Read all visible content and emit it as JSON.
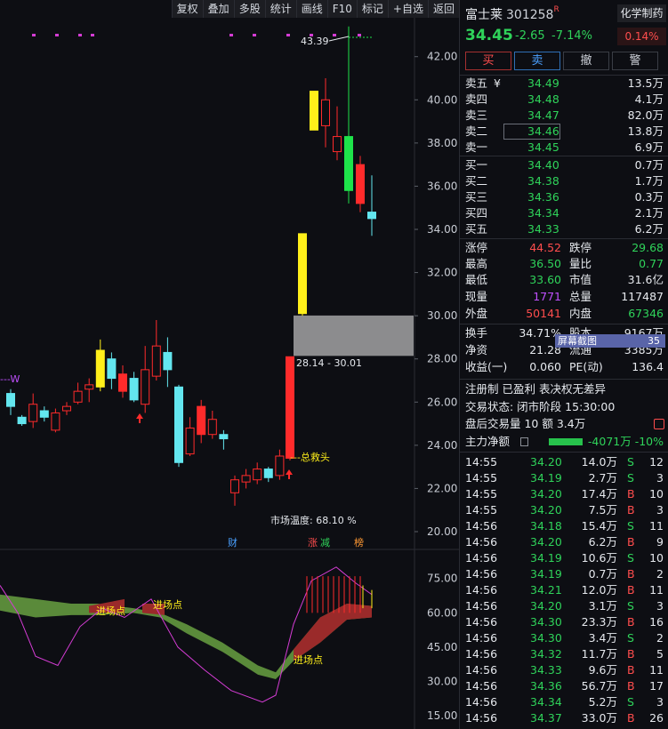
{
  "toolbar": {
    "items": [
      "复权",
      "叠加",
      "多股",
      "统计",
      "画线",
      "F10",
      "标记",
      "+自选",
      "返回"
    ]
  },
  "chart_data": {
    "type": "candlestick",
    "price_axis": [
      42.0,
      40.0,
      38.0,
      36.0,
      34.0,
      32.0,
      30.0,
      28.0,
      26.0,
      24.0,
      22.0,
      20.0
    ],
    "y_range": [
      19.3,
      43.8
    ],
    "candles": [
      {
        "o": 25.8,
        "c": 26.4,
        "h": 26.6,
        "l": 25.4,
        "color": "cyan"
      },
      {
        "o": 25.0,
        "c": 25.3,
        "h": 25.4,
        "l": 24.9,
        "color": "cyan"
      },
      {
        "o": 25.1,
        "c": 25.9,
        "h": 26.4,
        "l": 24.8,
        "color": "red"
      },
      {
        "o": 25.3,
        "c": 25.6,
        "h": 25.8,
        "l": 25.1,
        "color": "cyan"
      },
      {
        "o": 24.7,
        "c": 25.5,
        "h": 25.7,
        "l": 24.6,
        "color": "red"
      },
      {
        "o": 25.6,
        "c": 25.8,
        "h": 26.0,
        "l": 25.4,
        "color": "red"
      },
      {
        "o": 26.0,
        "c": 26.5,
        "h": 26.9,
        "l": 25.9,
        "color": "red"
      },
      {
        "o": 26.6,
        "c": 26.8,
        "h": 27.1,
        "l": 26.0,
        "color": "red"
      },
      {
        "o": 26.7,
        "c": 28.4,
        "h": 28.9,
        "l": 26.5,
        "color": "yellow"
      },
      {
        "o": 28.0,
        "c": 27.1,
        "h": 28.3,
        "l": 26.6,
        "color": "cyan"
      },
      {
        "o": 27.3,
        "c": 26.5,
        "h": 27.7,
        "l": 26.2,
        "color": "red"
      },
      {
        "o": 27.1,
        "c": 26.1,
        "h": 27.4,
        "l": 26.0,
        "color": "cyan"
      },
      {
        "o": 25.9,
        "c": 27.5,
        "h": 28.6,
        "l": 25.5,
        "color": "red"
      },
      {
        "o": 27.2,
        "c": 28.6,
        "h": 29.8,
        "l": 27.0,
        "color": "red"
      },
      {
        "o": 28.3,
        "c": 27.5,
        "h": 29.0,
        "l": 26.7,
        "color": "cyan"
      },
      {
        "o": 26.7,
        "c": 23.2,
        "h": 26.8,
        "l": 23.0,
        "color": "cyan"
      },
      {
        "o": 23.6,
        "c": 24.8,
        "h": 25.3,
        "l": 23.5,
        "color": "red"
      },
      {
        "o": 25.8,
        "c": 24.5,
        "h": 26.1,
        "l": 24.1,
        "color": "red"
      },
      {
        "o": 24.5,
        "c": 25.2,
        "h": 25.6,
        "l": 24.3,
        "color": "red"
      },
      {
        "o": 24.5,
        "c": 24.3,
        "h": 24.7,
        "l": 23.8,
        "color": "cyan"
      },
      {
        "o": 21.8,
        "c": 22.4,
        "h": 22.6,
        "l": 21.2,
        "color": "red"
      },
      {
        "o": 22.3,
        "c": 22.6,
        "h": 22.9,
        "l": 22.0,
        "color": "red"
      },
      {
        "o": 22.4,
        "c": 22.9,
        "h": 23.2,
        "l": 22.2,
        "color": "red"
      },
      {
        "o": 22.9,
        "c": 22.5,
        "h": 23.0,
        "l": 22.3,
        "color": "cyan"
      },
      {
        "o": 22.6,
        "c": 23.5,
        "h": 23.8,
        "l": 22.4,
        "color": "red"
      },
      {
        "o": 23.4,
        "c": 28.1,
        "h": 28.1,
        "l": 23.3,
        "color": "red"
      },
      {
        "o": 30.1,
        "c": 33.8,
        "h": 33.8,
        "l": 30.0,
        "color": "yellow"
      },
      {
        "o": 38.6,
        "c": 40.4,
        "h": 40.4,
        "l": 38.6,
        "color": "yellow"
      },
      {
        "o": 38.8,
        "c": 40.0,
        "h": 41.0,
        "l": 37.8,
        "color": "red"
      },
      {
        "o": 37.6,
        "c": 38.3,
        "h": 39.7,
        "l": 37.2,
        "color": "red"
      },
      {
        "o": 38.3,
        "c": 35.8,
        "h": 43.4,
        "l": 35.2,
        "color": "green"
      },
      {
        "o": 37.0,
        "c": 35.2,
        "h": 37.4,
        "l": 34.8,
        "color": "red"
      },
      {
        "o": 34.8,
        "c": 34.5,
        "h": 36.5,
        "l": 33.7,
        "color": "cyan"
      }
    ],
    "annotations": {
      "high_label": "43.39",
      "gap_label": "28.14 - 30.01",
      "rescue_label": "总救头",
      "w_label": "W",
      "market_temp": "市场温度: 68.10 %",
      "tags": [
        "财",
        "涨",
        "减",
        "榜"
      ]
    },
    "indicator_axis": [
      75.0,
      60.0,
      45.0,
      30.0,
      15.0
    ],
    "indicator_labels": [
      "进场点",
      "进场点",
      "进场点"
    ]
  },
  "stock": {
    "name": "富士莱",
    "code": "301258",
    "badge": "R",
    "sector": "化学制药",
    "price": "34.45",
    "change": "-2.65",
    "change_pct": "-7.14%",
    "small_pct": "0.14%"
  },
  "actions": [
    "买",
    "卖",
    "撤",
    "警"
  ],
  "asks": [
    {
      "label": "卖五",
      "price": "34.49",
      "vol": "13.5万",
      "mark": "¥"
    },
    {
      "label": "卖四",
      "price": "34.48",
      "vol": "4.1万",
      "mark": ""
    },
    {
      "label": "卖三",
      "price": "34.47",
      "vol": "82.0万",
      "mark": ""
    },
    {
      "label": "卖二",
      "price": "34.46",
      "vol": "13.8万",
      "mark": ""
    },
    {
      "label": "卖一",
      "price": "34.45",
      "vol": "6.9万",
      "mark": ""
    }
  ],
  "bids": [
    {
      "label": "买一",
      "price": "34.40",
      "vol": "0.7万"
    },
    {
      "label": "买二",
      "price": "34.38",
      "vol": "1.7万"
    },
    {
      "label": "买三",
      "price": "34.36",
      "vol": "0.3万"
    },
    {
      "label": "买四",
      "price": "34.34",
      "vol": "2.1万"
    },
    {
      "label": "买五",
      "price": "34.33",
      "vol": "6.2万"
    }
  ],
  "stats": {
    "zt_label": "涨停",
    "zt": "44.52",
    "dt_label": "跌停",
    "dt": "29.68",
    "high_label": "最高",
    "high": "36.50",
    "lb_label": "量比",
    "lb": "0.77",
    "low_label": "最低",
    "low": "33.60",
    "sz_label": "市值",
    "sz": "31.6亿",
    "xl_label": "现量",
    "xl": "1771",
    "zl_label": "总量",
    "zl": "117487",
    "wp_label": "外盘",
    "wp": "50141",
    "np_label": "内盘",
    "np": "67346",
    "hs_label": "换手",
    "hs": "34.71%",
    "gb_label": "股本",
    "gb": "9167万",
    "jz_label": "净资",
    "jz": "21.28",
    "lt_label": "流通",
    "lt": "3385万",
    "sy_label": "收益(一)",
    "sy": "0.060",
    "pe_label": "PE(动)",
    "pe": "136.4",
    "screenshot_tip": "屏幕截图",
    "tip_num": "35"
  },
  "info": {
    "line1": "注册制 已盈利 表决权无差异",
    "line2": "交易状态: 闭市阶段 15:30:00",
    "line3": "盘后交易量 10 额 3.4万",
    "line4_label": "主力净额",
    "line4_value": "-4071万 -10%"
  },
  "ticks": [
    {
      "t": "14:55",
      "p": "34.20",
      "v": "14.0万",
      "d": "S",
      "n": "12"
    },
    {
      "t": "14:55",
      "p": "34.19",
      "v": "2.7万",
      "d": "S",
      "n": "3"
    },
    {
      "t": "14:55",
      "p": "34.20",
      "v": "17.4万",
      "d": "B",
      "n": "10"
    },
    {
      "t": "14:55",
      "p": "34.20",
      "v": "7.5万",
      "d": "B",
      "n": "3"
    },
    {
      "t": "14:56",
      "p": "34.18",
      "v": "15.4万",
      "d": "S",
      "n": "11"
    },
    {
      "t": "14:56",
      "p": "34.20",
      "v": "6.2万",
      "d": "B",
      "n": "9"
    },
    {
      "t": "14:56",
      "p": "34.19",
      "v": "10.6万",
      "d": "S",
      "n": "10"
    },
    {
      "t": "14:56",
      "p": "34.19",
      "v": "0.7万",
      "d": "B",
      "n": "2"
    },
    {
      "t": "14:56",
      "p": "34.21",
      "v": "12.0万",
      "d": "B",
      "n": "11"
    },
    {
      "t": "14:56",
      "p": "34.20",
      "v": "3.1万",
      "d": "S",
      "n": "3"
    },
    {
      "t": "14:56",
      "p": "34.30",
      "v": "23.3万",
      "d": "B",
      "n": "16"
    },
    {
      "t": "14:56",
      "p": "34.30",
      "v": "3.4万",
      "d": "S",
      "n": "2"
    },
    {
      "t": "14:56",
      "p": "34.32",
      "v": "11.7万",
      "d": "B",
      "n": "5"
    },
    {
      "t": "14:56",
      "p": "34.33",
      "v": "9.6万",
      "d": "B",
      "n": "11"
    },
    {
      "t": "14:56",
      "p": "34.36",
      "v": "56.7万",
      "d": "B",
      "n": "17"
    },
    {
      "t": "14:56",
      "p": "34.34",
      "v": "5.2万",
      "d": "S",
      "n": "3"
    },
    {
      "t": "14:56",
      "p": "34.37",
      "v": "33.0万",
      "d": "B",
      "n": "26"
    }
  ]
}
